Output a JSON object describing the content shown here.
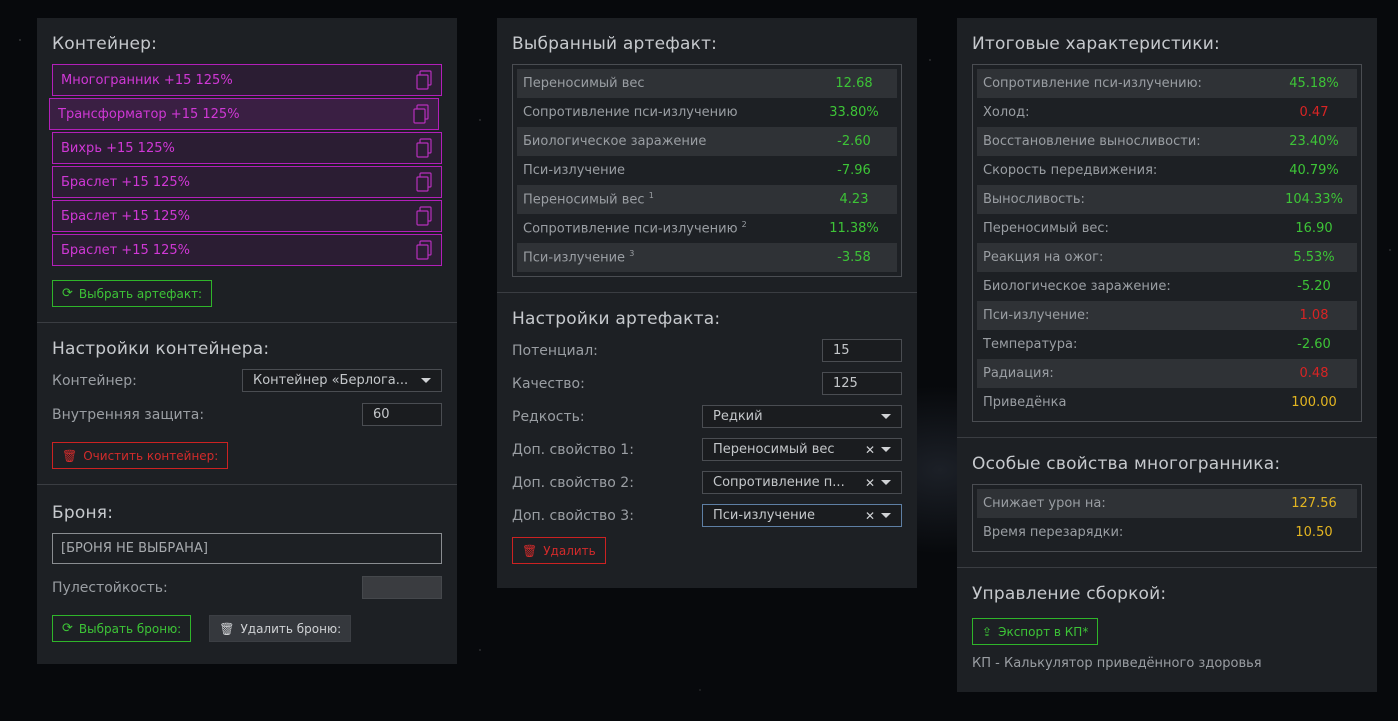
{
  "colors": {
    "green": "#3dc437",
    "red": "#d82424",
    "yellow": "#e3b521",
    "purple": "#d038d6"
  },
  "left": {
    "container_title": "Контейнер:",
    "artifacts": [
      {
        "label": "Многогранник +15 125%",
        "icon": "copy-icon"
      },
      {
        "label": "Трансформатор +15 125%",
        "icon": "copy-icon"
      },
      {
        "label": "Вихрь +15 125%",
        "icon": "copy-icon"
      },
      {
        "label": "Браслет +15 125%",
        "icon": "copy-icon"
      },
      {
        "label": "Браслет +15 125%",
        "icon": "copy-icon"
      },
      {
        "label": "Браслет +15 125%",
        "icon": "copy-icon"
      }
    ],
    "select_artifact_button": "Выбрать артефакт:",
    "container_settings_title": "Настройки контейнера:",
    "container_label": "Контейнер:",
    "container_value": "Контейнер «Берлога...",
    "inner_protection_label": "Внутренняя защита:",
    "inner_protection_value": "60",
    "clear_container_button": "Очистить контейнер:",
    "armor_title": "Броня:",
    "armor_value": "[БРОНЯ НЕ ВЫБРАНА]",
    "bulletproof_label": "Пулестойкость:",
    "bulletproof_value": "",
    "select_armor_button": "Выбрать броню:",
    "delete_armor_button": "Удалить броню:"
  },
  "middle": {
    "selected_title": "Выбранный артефакт:",
    "stats": [
      {
        "label": "Переносимый вес",
        "sup": "",
        "value": "12.68",
        "color": "g"
      },
      {
        "label": "Сопротивление пси-излучению",
        "sup": "",
        "value": "33.80%",
        "color": "g"
      },
      {
        "label": "Биологическое заражение",
        "sup": "",
        "value": "-2.60",
        "color": "g"
      },
      {
        "label": "Пси-излучение",
        "sup": "",
        "value": "-7.96",
        "color": "g"
      },
      {
        "label": "Переносимый вес",
        "sup": "1",
        "value": "4.23",
        "color": "g"
      },
      {
        "label": "Сопротивление пси-излучению",
        "sup": "2",
        "value": "11.38%",
        "color": "g"
      },
      {
        "label": "Пси-излучение",
        "sup": "3",
        "value": "-3.58",
        "color": "g"
      }
    ],
    "settings_title": "Настройки артефакта:",
    "potential_label": "Потенциал:",
    "potential_value": "15",
    "quality_label": "Качество:",
    "quality_value": "125",
    "rarity_label": "Редкость:",
    "rarity_value": "Редкий",
    "extra1_label": "Доп. свойство 1:",
    "extra1_value": "Переносимый вес",
    "extra2_label": "Доп. свойство 2:",
    "extra2_value": "Сопротивление п...",
    "extra3_label": "Доп. свойство 3:",
    "extra3_value": "Пси-излучение",
    "delete_button": "Удалить"
  },
  "right": {
    "totals_title": "Итоговые характеристики:",
    "totals": [
      {
        "label": "Сопротивление пси-излучению:",
        "value": "45.18%",
        "color": "g"
      },
      {
        "label": "Холод:",
        "value": "0.47",
        "color": "r"
      },
      {
        "label": "Восстановление выносливости:",
        "value": "23.40%",
        "color": "g"
      },
      {
        "label": "Скорость передвижения:",
        "value": "40.79%",
        "color": "g"
      },
      {
        "label": "Выносливость:",
        "value": "104.33%",
        "color": "g"
      },
      {
        "label": "Переносимый вес:",
        "value": "16.90",
        "color": "g"
      },
      {
        "label": "Реакция на ожог:",
        "value": "5.53%",
        "color": "g"
      },
      {
        "label": "Биологическое заражение:",
        "value": "-5.20",
        "color": "g"
      },
      {
        "label": "Пси-излучение:",
        "value": "1.08",
        "color": "r"
      },
      {
        "label": "Температура:",
        "value": "-2.60",
        "color": "g"
      },
      {
        "label": "Радиация:",
        "value": "0.48",
        "color": "r"
      },
      {
        "label": "Приведёнка",
        "value": "100.00",
        "color": "y"
      }
    ],
    "special_title": "Особые свойства многогранника:",
    "special": [
      {
        "label": "Снижает урон на:",
        "value": "127.56",
        "color": "y"
      },
      {
        "label": "Время перезарядки:",
        "value": "10.50",
        "color": "y"
      }
    ],
    "build_title": "Управление сборкой:",
    "export_button": "Экспорт в КП*",
    "footnote": "КП - Калькулятор приведённого здоровья"
  }
}
